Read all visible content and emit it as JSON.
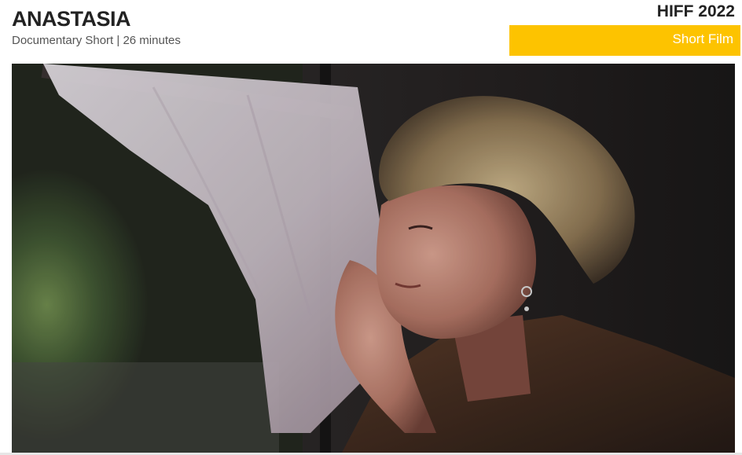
{
  "film": {
    "title": "ANASTASIA",
    "meta": "Documentary Short | 26 minutes"
  },
  "festival": {
    "label": "HIFF 2022",
    "category": "Short Film",
    "accent_color": "#fdc300"
  },
  "still": {
    "icon": "film-still-image"
  }
}
